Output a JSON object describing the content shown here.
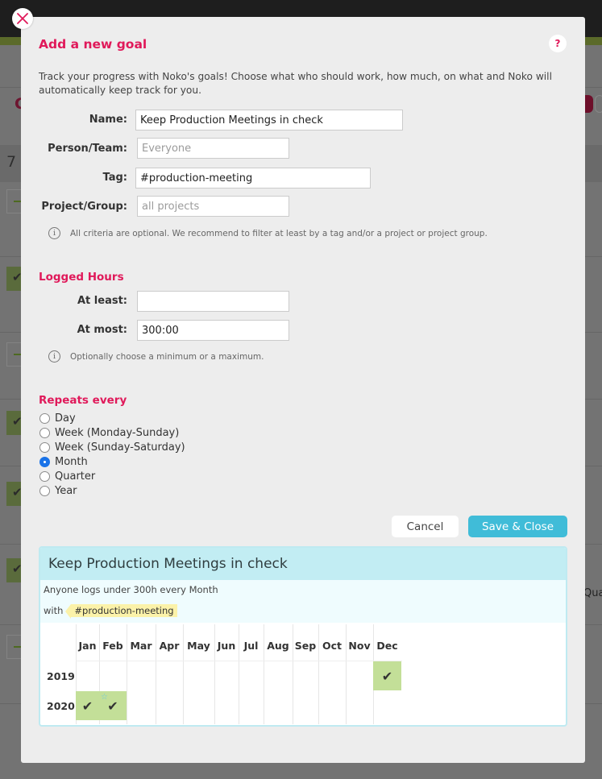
{
  "background": {
    "count_prefix": "7 C",
    "heading_initial": "C",
    "partial_text": "Qua"
  },
  "modal": {
    "title": "Add a new goal",
    "help_label": "?",
    "intro": "Track your progress with Noko's goals! Choose what who should work, how much, on what and Noko will automatically keep track for you.",
    "fields": {
      "name": {
        "label": "Name:",
        "value": "Keep Production Meetings in check",
        "placeholder": ""
      },
      "person_team": {
        "label": "Person/Team:",
        "value": "",
        "placeholder": "Everyone"
      },
      "tag": {
        "label": "Tag:",
        "value": "#production-meeting",
        "placeholder": ""
      },
      "project_group": {
        "label": "Project/Group:",
        "value": "",
        "placeholder": "all projects"
      }
    },
    "criteria_hint": "All criteria are optional. We recommend to filter at least by a tag and/or a project or project group.",
    "logged_hours": {
      "heading": "Logged Hours",
      "at_least": {
        "label": "At least:",
        "value": ""
      },
      "at_most": {
        "label": "At most:",
        "value": "300:00"
      },
      "hint": "Optionally choose a minimum or a maximum."
    },
    "repeats": {
      "heading": "Repeats every",
      "options": [
        {
          "label": "Day",
          "checked": false
        },
        {
          "label": "Week (Monday-Sunday)",
          "checked": false
        },
        {
          "label": "Week (Sunday-Saturday)",
          "checked": false
        },
        {
          "label": "Month",
          "checked": true
        },
        {
          "label": "Quarter",
          "checked": false
        },
        {
          "label": "Year",
          "checked": false
        }
      ]
    },
    "buttons": {
      "cancel": "Cancel",
      "save": "Save & Close"
    },
    "preview": {
      "title": "Keep Production Meetings in check",
      "description": "Anyone logs under 300h every Month",
      "with_label": "with",
      "tag": "#production-meeting",
      "months": [
        "Jan",
        "Feb",
        "Mar",
        "Apr",
        "May",
        "Jun",
        "Jul",
        "Aug",
        "Sep",
        "Oct",
        "Nov",
        "Dec"
      ],
      "years": [
        {
          "year": "2019",
          "met": [
            "Dec"
          ]
        },
        {
          "year": "2020",
          "met": [
            "Jan",
            "Feb"
          ],
          "current": "Feb"
        }
      ]
    }
  },
  "colors": {
    "accent": "#e0195a",
    "primary_button": "#40bcd8",
    "goal_met": "#c3df98",
    "radio_selected": "#1a73e8"
  }
}
